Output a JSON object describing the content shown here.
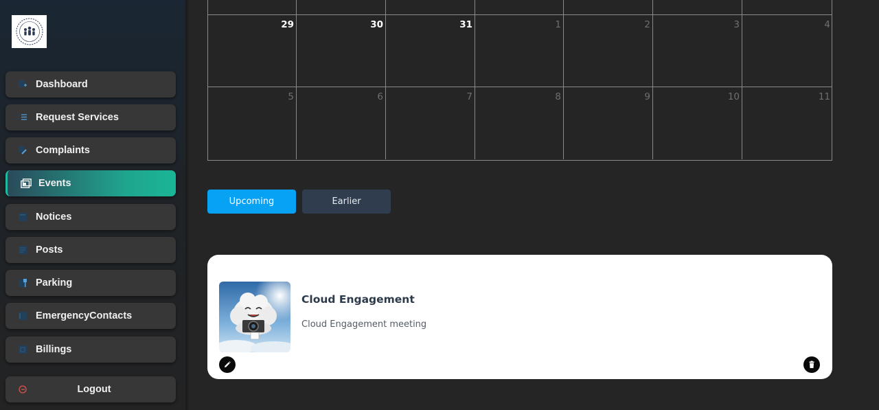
{
  "sidebar": {
    "logo_icon": "community-logo-icon",
    "items": [
      {
        "label": "Dashboard",
        "icon": "dashboard-icon"
      },
      {
        "label": "Request Services",
        "icon": "list-icon"
      },
      {
        "label": "Complaints",
        "icon": "pen-icon"
      },
      {
        "label": "Events",
        "icon": "calendar-icon",
        "active": true
      },
      {
        "label": "Notices",
        "icon": "notice-icon"
      },
      {
        "label": "Posts",
        "icon": "post-icon"
      },
      {
        "label": "Parking",
        "icon": "parking-icon"
      },
      {
        "label": "EmergencyContacts",
        "icon": "contacts-icon"
      },
      {
        "label": "Billings",
        "icon": "billing-icon"
      }
    ],
    "logout_label": "Logout"
  },
  "calendar": {
    "week1": [
      {
        "day": "29",
        "current_month": true
      },
      {
        "day": "30",
        "current_month": true
      },
      {
        "day": "31",
        "current_month": true
      },
      {
        "day": "1",
        "current_month": false
      },
      {
        "day": "2",
        "current_month": false
      },
      {
        "day": "3",
        "current_month": false
      },
      {
        "day": "4",
        "current_month": false
      }
    ],
    "week2": [
      {
        "day": "5",
        "current_month": false
      },
      {
        "day": "6",
        "current_month": false
      },
      {
        "day": "7",
        "current_month": false
      },
      {
        "day": "8",
        "current_month": false
      },
      {
        "day": "9",
        "current_month": false
      },
      {
        "day": "10",
        "current_month": false
      },
      {
        "day": "11",
        "current_month": false
      }
    ]
  },
  "filters": {
    "upcoming_label": "Upcoming",
    "earlier_label": "Earlier",
    "active": "Upcoming"
  },
  "events": [
    {
      "title": "Cloud Engagement",
      "description": "Cloud Engagement meeting",
      "image_icon": "cloud-camera-image"
    }
  ],
  "colors": {
    "accent_blue": "#08a2f5",
    "active_nav_gradient_end": "#1ab597",
    "background": "#252525"
  }
}
